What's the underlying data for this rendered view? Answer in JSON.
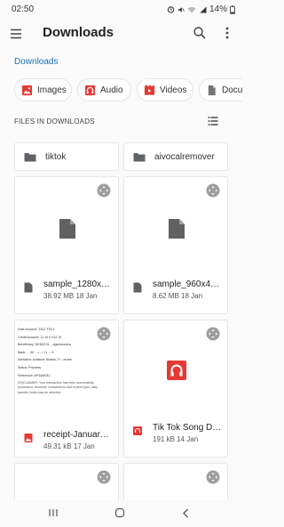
{
  "status_bar": {
    "time": "02:50",
    "battery": "14%"
  },
  "app_bar": {
    "title": "Downloads"
  },
  "breadcrumb": "Downloads",
  "filter_chips": [
    {
      "label": "Images",
      "icon": "image-icon",
      "color": "#e53935"
    },
    {
      "label": "Audio",
      "icon": "headphones-icon",
      "color": "#e53935"
    },
    {
      "label": "Videos",
      "icon": "movie-icon",
      "color": "#e53935"
    },
    {
      "label": "Docu",
      "icon": "document-icon",
      "color": "#757575"
    }
  ],
  "section_header": "FILES IN DOWNLOADS",
  "folders": [
    {
      "name": "tiktok"
    },
    {
      "name": "aivocalremover"
    }
  ],
  "files": [
    {
      "name": "sample_1280x…",
      "size": "38.92 MB",
      "date": "18 Jan",
      "type_icon": "file-icon"
    },
    {
      "name": "sample_960x4…",
      "size": "8.62 MB",
      "date": "18 Jan",
      "type_icon": "file-icon"
    },
    {
      "name": "receipt-Januar…",
      "size": "49.31 kB",
      "date": "17 Jan",
      "type_icon": "image-icon"
    },
    {
      "name": "Tik Tok Song D…",
      "size": "191 kB",
      "date": "14 Jan",
      "type_icon": "headphones-icon"
    }
  ],
  "receipt_preview": {
    "lines": [
      "Date Account: 2312 TSC1",
      "Credit Account: 11 10 0 013 10",
      "Beneficiary: DKMICS1 ...vgsnnmnnns",
      "Bank: ... tlil ... r... r t t ... l t",
      "Narration: #vaticlar, 8natus, Tr - zsoee",
      "Status: Pnocess",
      "Reference: AP34W041"
    ],
    "disclaimer": "DISCLAIMER: Your transaction has been successfully processed. However, transactions that exceed your daily transfer limits may be affected."
  },
  "colors": {
    "accent": "#1a73b8",
    "audio_red": "#e53935",
    "file_grey": "#616161"
  }
}
